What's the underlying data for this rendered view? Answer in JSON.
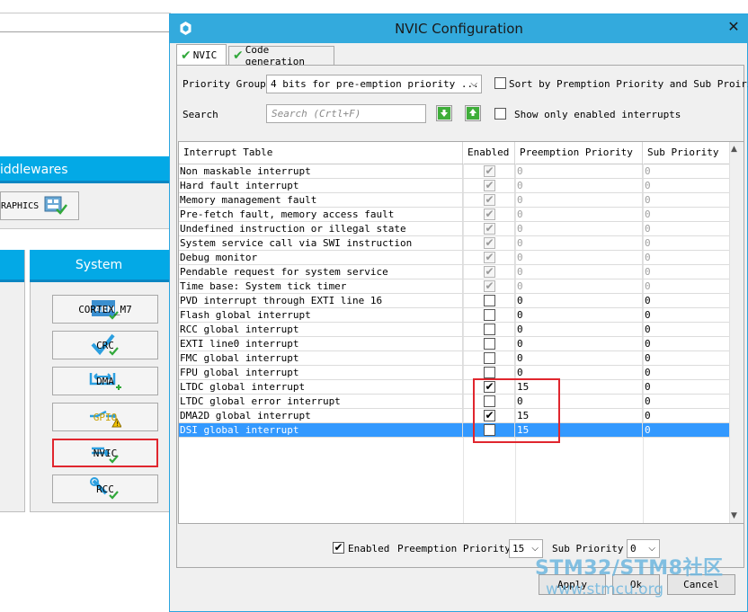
{
  "background_app": {
    "middlewares_header": "iddlewares",
    "graphics_button": "RAPHICS",
    "system_header": "System",
    "system_buttons": [
      {
        "label": "CORTEX_M7",
        "icon": "arm-icon",
        "state": "ok"
      },
      {
        "label": "CRC",
        "icon": "checkmark-icon",
        "state": "ok"
      },
      {
        "label": "DMA",
        "icon": "dma-icon",
        "state": "ok"
      },
      {
        "label": "GPIO",
        "icon": "gpio-warning-icon",
        "state": "warning"
      },
      {
        "label": "NVIC",
        "icon": "nvic-icon",
        "state": "ok"
      },
      {
        "label": "RCC",
        "icon": "wrench-icon",
        "state": "ok"
      }
    ]
  },
  "dialog": {
    "title": "NVIC Configuration",
    "close_glyph": "✕",
    "tabs": [
      {
        "label": "NVIC",
        "active": true
      },
      {
        "label": "Code generation",
        "active": false
      }
    ],
    "priority_group_label": "Priority Group",
    "priority_group_value": "4 bits for pre-emption priority ...",
    "sort_label": "Sort by Premption Priority and Sub Proirity",
    "search_label": "Search",
    "search_placeholder": "Search (Crtl+F)",
    "show_enabled_label": "Show only enabled interrupts",
    "table": {
      "headers": [
        "Interrupt Table",
        "Enabled",
        "Preemption Priority",
        "Sub Priority"
      ],
      "rows": [
        {
          "name": "Non maskable interrupt",
          "enabled": true,
          "locked": true,
          "preemption": "0",
          "sub": "0"
        },
        {
          "name": "Hard fault interrupt",
          "enabled": true,
          "locked": true,
          "preemption": "0",
          "sub": "0"
        },
        {
          "name": "Memory management fault",
          "enabled": true,
          "locked": true,
          "preemption": "0",
          "sub": "0"
        },
        {
          "name": "Pre-fetch fault, memory access fault",
          "enabled": true,
          "locked": true,
          "preemption": "0",
          "sub": "0"
        },
        {
          "name": "Undefined instruction or illegal state",
          "enabled": true,
          "locked": true,
          "preemption": "0",
          "sub": "0"
        },
        {
          "name": "System service call via SWI instruction",
          "enabled": true,
          "locked": true,
          "preemption": "0",
          "sub": "0"
        },
        {
          "name": "Debug monitor",
          "enabled": true,
          "locked": true,
          "preemption": "0",
          "sub": "0"
        },
        {
          "name": "Pendable request for system service",
          "enabled": true,
          "locked": true,
          "preemption": "0",
          "sub": "0"
        },
        {
          "name": "Time base: System tick timer",
          "enabled": true,
          "locked": true,
          "preemption": "0",
          "sub": "0"
        },
        {
          "name": "PVD interrupt through EXTI line 16",
          "enabled": false,
          "locked": false,
          "preemption": "0",
          "sub": "0"
        },
        {
          "name": "Flash global interrupt",
          "enabled": false,
          "locked": false,
          "preemption": "0",
          "sub": "0"
        },
        {
          "name": "RCC global interrupt",
          "enabled": false,
          "locked": false,
          "preemption": "0",
          "sub": "0"
        },
        {
          "name": "EXTI line0 interrupt",
          "enabled": false,
          "locked": false,
          "preemption": "0",
          "sub": "0"
        },
        {
          "name": "FMC global interrupt",
          "enabled": false,
          "locked": false,
          "preemption": "0",
          "sub": "0"
        },
        {
          "name": "FPU global interrupt",
          "enabled": false,
          "locked": false,
          "preemption": "0",
          "sub": "0"
        },
        {
          "name": "LTDC global interrupt",
          "enabled": true,
          "locked": false,
          "preemption": "15",
          "sub": "0"
        },
        {
          "name": "LTDC global error interrupt",
          "enabled": false,
          "locked": false,
          "preemption": "0",
          "sub": "0"
        },
        {
          "name": "DMA2D global interrupt",
          "enabled": true,
          "locked": false,
          "preemption": "15",
          "sub": "0"
        },
        {
          "name": "DSI global interrupt",
          "enabled": true,
          "locked": false,
          "preemption": "15",
          "sub": "0",
          "selected": true
        }
      ]
    },
    "footer": {
      "enabled_label": "Enabled",
      "preemption_label": "Preemption Priority",
      "preemption_value": "15",
      "sub_label": "Sub Priority",
      "sub_value": "0",
      "apply_label": "Apply",
      "ok_label": "Ok",
      "cancel_label": "Cancel"
    }
  },
  "watermark": {
    "line1": "STM32/STM8社区",
    "line2": "www.stmcu.org"
  },
  "colors": {
    "accent_blue": "#03a9e6",
    "titlebar": "#33aadd",
    "selection": "#3399ff",
    "highlight_red": "#e0262e",
    "check_green": "#31a83a"
  }
}
